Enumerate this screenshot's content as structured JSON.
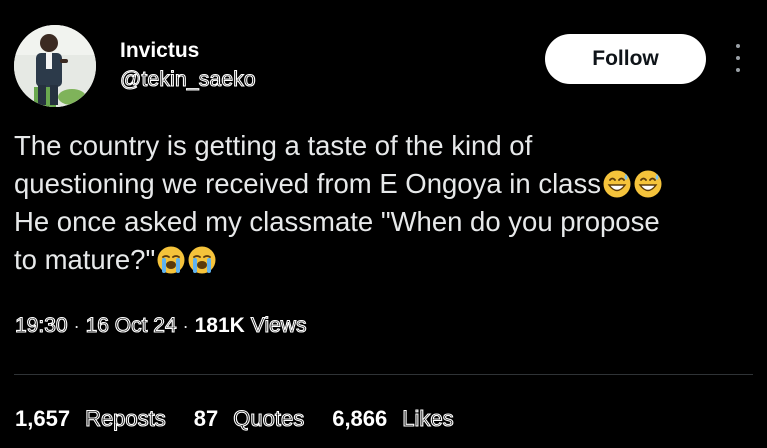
{
  "user": {
    "name": "Invictus",
    "handle": "@tekin_saeko"
  },
  "follow_label": "Follow",
  "tweet": {
    "lines": [
      "The country is getting a taste of the kind of",
      "questioning we received from E Ongoya in class",
      "He once asked my classmate \"When do you propose",
      "to mature?\""
    ],
    "emojis_line2": [
      "grinning-sweat-emoji",
      "grinning-sweat-emoji"
    ],
    "emojis_line4": [
      "loudly-crying-emoji",
      "loudly-crying-emoji"
    ]
  },
  "meta": {
    "time": "19:30",
    "date": "16 Oct 24",
    "views_count": "181K",
    "views_label": "Views"
  },
  "stats": {
    "reposts_count": "1,657",
    "reposts_label": "Reposts",
    "quotes_count": "87",
    "quotes_label": "Quotes",
    "likes_count": "6,866",
    "likes_label": "Likes"
  },
  "colors": {
    "background": "#000000",
    "text": "#e7e9ea",
    "follow_bg": "#ffffff",
    "follow_text": "#0f1419",
    "divider": "#2f3336",
    "emoji_yellow": "#f5c33b"
  }
}
